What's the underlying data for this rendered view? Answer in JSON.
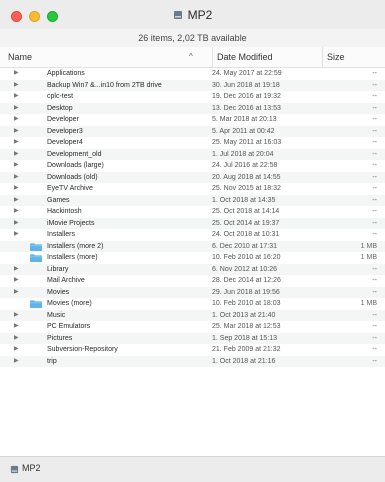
{
  "window": {
    "title": "MP2",
    "status": "26 items, 2,02 TB available",
    "path_label": "MP2",
    "accent_folder_color": "#5fb3e6"
  },
  "columns": {
    "name": "Name",
    "sort_indicator": "^",
    "date": "Date Modified",
    "size": "Size"
  },
  "rows": [
    {
      "name": "Applications",
      "date": "24. May 2017 at 22:59",
      "size": "--",
      "type": "disclosure"
    },
    {
      "name": "Backup Win7 &...in10 from 2TB drive",
      "date": "30. Jun 2018 at 19:18",
      "size": "--",
      "type": "disclosure"
    },
    {
      "name": "cplc-test",
      "date": "19. Dec 2016 at 19:32",
      "size": "--",
      "type": "disclosure"
    },
    {
      "name": "Desktop",
      "date": "13. Dec 2016 at 13:53",
      "size": "--",
      "type": "disclosure"
    },
    {
      "name": "Developer",
      "date": "5. Mar 2018 at 20:13",
      "size": "--",
      "type": "disclosure"
    },
    {
      "name": "Developer3",
      "date": "5. Apr 2011 at 00:42",
      "size": "--",
      "type": "disclosure"
    },
    {
      "name": "Developer4",
      "date": "25. May 2011 at 16:03",
      "size": "--",
      "type": "disclosure"
    },
    {
      "name": "Development_old",
      "date": "1. Jul 2018 at 20:04",
      "size": "--",
      "type": "disclosure"
    },
    {
      "name": "Downloads (large)",
      "date": "24. Jul 2016 at 22:58",
      "size": "--",
      "type": "disclosure"
    },
    {
      "name": "Downloads (old)",
      "date": "20. Aug 2018 at 14:55",
      "size": "--",
      "type": "disclosure"
    },
    {
      "name": "EyeTV Archive",
      "date": "25. Nov 2015 at 18:32",
      "size": "--",
      "type": "disclosure"
    },
    {
      "name": "Games",
      "date": "1. Oct 2018 at 14:35",
      "size": "--",
      "type": "disclosure"
    },
    {
      "name": "Hackintosh",
      "date": "25. Oct 2018 at 14:14",
      "size": "--",
      "type": "disclosure"
    },
    {
      "name": "iMovie Projects",
      "date": "25. Oct 2014 at 19:37",
      "size": "--",
      "type": "disclosure"
    },
    {
      "name": "Installers",
      "date": "24. Oct 2018 at 10:31",
      "size": "--",
      "type": "disclosure"
    },
    {
      "name": "Installers (more 2)",
      "date": "6. Dec 2010 at 17:31",
      "size": "1 MB",
      "type": "alias"
    },
    {
      "name": "Installers (more)",
      "date": "10. Feb 2010 at 16:20",
      "size": "1 MB",
      "type": "alias"
    },
    {
      "name": "Library",
      "date": "6. Nov 2012 at 10:26",
      "size": "--",
      "type": "disclosure"
    },
    {
      "name": "Mail Archive",
      "date": "28. Dec 2014 at 12:26",
      "size": "--",
      "type": "disclosure"
    },
    {
      "name": "Movies",
      "date": "29. Jun 2018 at 19:56",
      "size": "--",
      "type": "disclosure"
    },
    {
      "name": "Movies (more)",
      "date": "10. Feb 2010 at 18:03",
      "size": "1 MB",
      "type": "alias"
    },
    {
      "name": "Music",
      "date": "1. Oct 2013 at 21:40",
      "size": "--",
      "type": "disclosure"
    },
    {
      "name": "PC Emulators",
      "date": "25. Mar 2018 at 12:53",
      "size": "--",
      "type": "disclosure"
    },
    {
      "name": "Pictures",
      "date": "1. Sep 2018 at 15:13",
      "size": "--",
      "type": "disclosure"
    },
    {
      "name": "Subversion-Repository",
      "date": "21. Feb 2009 at 21:32",
      "size": "--",
      "type": "disclosure"
    },
    {
      "name": "trip",
      "date": "1. Oct 2018 at 21:16",
      "size": "--",
      "type": "disclosure"
    }
  ]
}
